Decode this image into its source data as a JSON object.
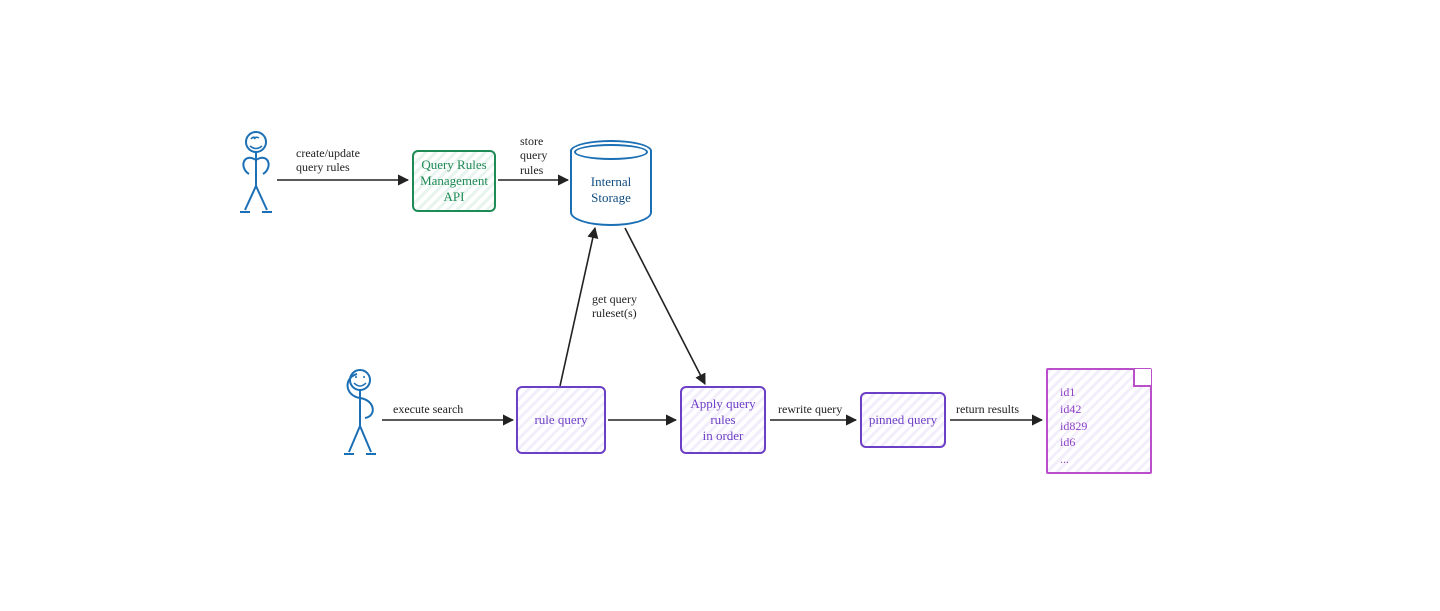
{
  "colors": {
    "purple": "#6d3fc6",
    "green": "#1e8a55",
    "blue": "#1b6fb5",
    "magenta": "#b94fc9",
    "ink": "#222222"
  },
  "actors": {
    "admin": "admin-user",
    "searcher": "search-user"
  },
  "arrows": {
    "create_update": "create/update\nquery rules",
    "store": "store\nquery\nrules",
    "get_ruleset": "get query\nruleset(s)",
    "execute_search": "execute search",
    "rewrite_query": "rewrite query",
    "return_results": "return results"
  },
  "nodes": {
    "api": "Query Rules\nManagement\nAPI",
    "storage": "Internal\nStorage",
    "rule_query": "rule query",
    "apply_rules": "Apply query\nrules\nin order",
    "pinned_query": "pinned query"
  },
  "results": {
    "items": [
      "id1",
      "id42",
      "id829",
      "id6",
      "..."
    ]
  }
}
